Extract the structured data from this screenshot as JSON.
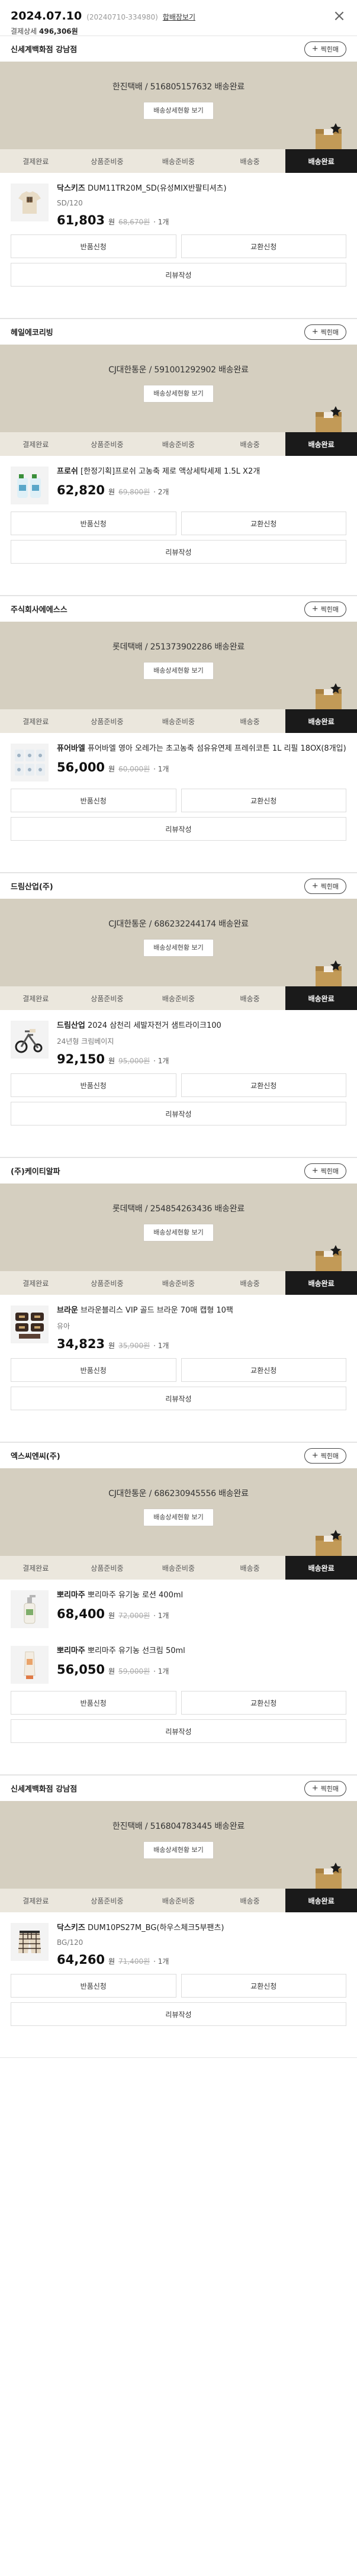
{
  "order": {
    "date": "2024.07.10",
    "number": "(20240710-334980)",
    "detail_link": "합배장보기",
    "payment_label": "결제상세",
    "payment_amount": "496,306원",
    "close_icon": "close-icon"
  },
  "labels": {
    "bookmark": "찍힌매",
    "tracking_button": "배송상세현황 보기",
    "steps": [
      "결제완료",
      "상품준비중",
      "배송준비중",
      "배송중",
      "배송완료"
    ],
    "return": "반품신청",
    "exchange": "교환신청",
    "review": "리뷰작성",
    "unit": "원"
  },
  "shipments": [
    {
      "seller": "신세계백화점 강남점",
      "tracking": "한진택배 / 516805157632 배송완료",
      "products": [
        {
          "brand": "닥스키즈",
          "name": "DUM11TR20M_SD(유성MIX반팔티셔츠)",
          "option": "SD/120",
          "price": "61,803",
          "original": "68,670원",
          "qty": "1개",
          "thumb": "kids-tshirt"
        }
      ]
    },
    {
      "seller": "헤일에코리빙",
      "tracking": "CJ대한통운 / 591001292902 배송완료",
      "products": [
        {
          "brand": "프로쉬",
          "name": "[한정기획]프로쉬 고농축 제로 액상세탁세제 1.5L X2개",
          "option": "",
          "price": "62,820",
          "original": "69,800원",
          "qty": "2개",
          "thumb": "detergent-bottles"
        }
      ]
    },
    {
      "seller": "주식회사에에스스",
      "tracking": "롯데택배 / 251373902286 배송완료",
      "products": [
        {
          "brand": "퓨어바엘",
          "name": "퓨어바엘 영아 오레가는 초고농축 섬유유연제 프레쉬코튼 1L 리필 18OX(8개입)",
          "option": "",
          "price": "56,000",
          "original": "60,000원",
          "qty": "1개",
          "thumb": "softener-pouches"
        }
      ]
    },
    {
      "seller": "드림산업(주)",
      "tracking": "CJ대한통운 / 686232244174 배송완료",
      "products": [
        {
          "brand": "드림산업",
          "name": "2024 삼천리 세발자전거 샘트라이크100",
          "option": "24년형 크림베이지",
          "price": "92,150",
          "original": "95,000원",
          "qty": "1개",
          "thumb": "tricycle"
        }
      ]
    },
    {
      "seller": "(주)케이티알파",
      "tracking": "롯데택배 / 254854263436 배송완료",
      "products": [
        {
          "brand": "브라운",
          "name": "브라운블리스 VIP 골드 브라운 70매 캡형 10팩",
          "option": "유아",
          "price": "34,823",
          "original": "35,900원",
          "qty": "1개",
          "thumb": "wipes-pack"
        }
      ]
    },
    {
      "seller": "엑스씨엔씨(주)",
      "tracking": "CJ대한통운 / 686230945556 배송완료",
      "products": [
        {
          "brand": "뽀리마주",
          "name": "뽀리마주 유기농 로션 400ml",
          "option": "",
          "price": "68,400",
          "original": "72,000원",
          "qty": "1개",
          "thumb": "lotion-bottle"
        },
        {
          "brand": "뽀리마주",
          "name": "뽀리마주 유기농 선크림 50ml",
          "option": "",
          "price": "56,050",
          "original": "59,000원",
          "qty": "1개",
          "thumb": "sunscreen-tube"
        }
      ]
    },
    {
      "seller": "신세계백화점 강남점",
      "tracking": "한진택배 / 516804783445 배송완료",
      "products": [
        {
          "brand": "닥스키즈",
          "name": "DUM10PS27M_BG(하우스체크5부팬츠)",
          "option": "BG/120",
          "price": "64,260",
          "original": "71,400원",
          "qty": "1개",
          "thumb": "check-pants"
        }
      ]
    }
  ],
  "colors": {
    "panel": "#d5cfc0",
    "steps_bg": "#ebe7dd",
    "active_step": "#1a1a1a"
  }
}
